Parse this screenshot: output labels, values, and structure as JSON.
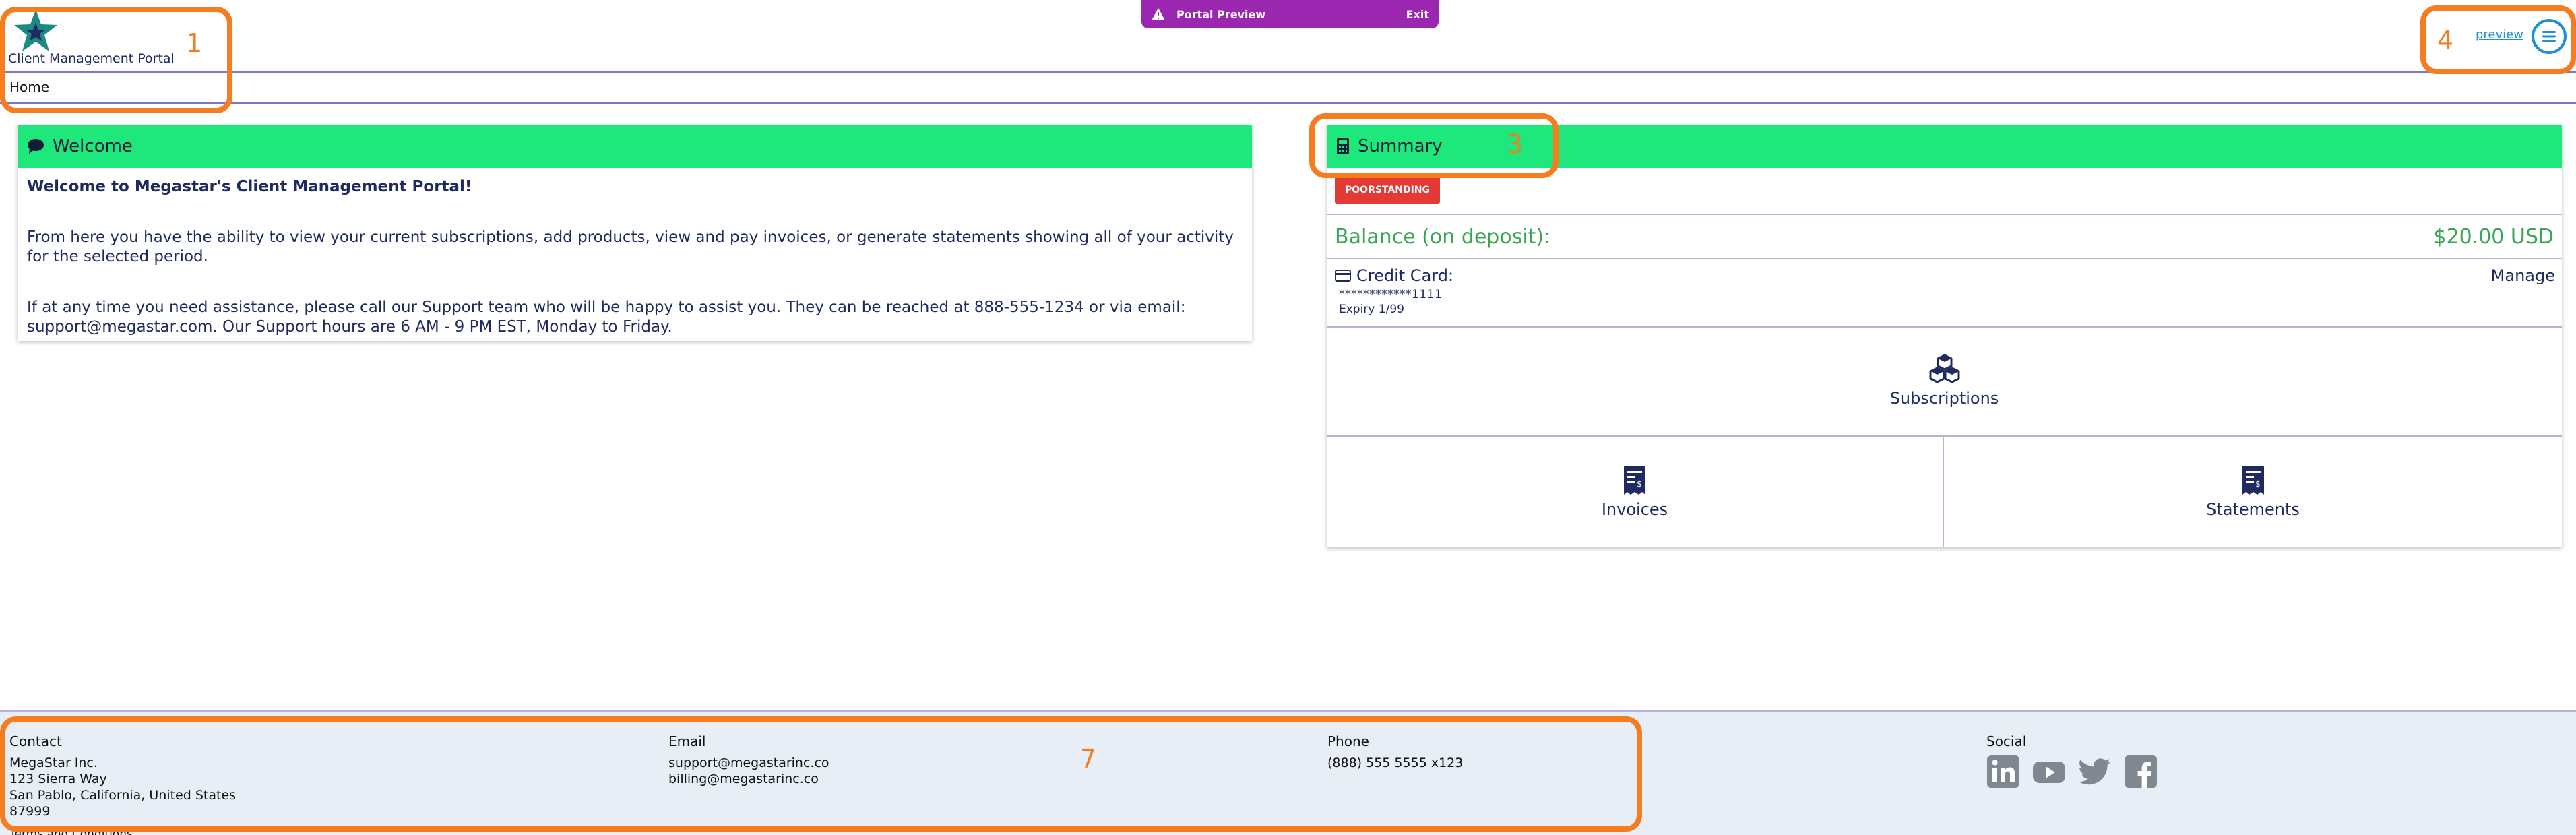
{
  "header": {
    "portal_name": "Client Management Portal",
    "preview_banner": {
      "label": "Portal Preview",
      "exit": "Exit"
    },
    "preview_link": "preview",
    "breadcrumb": "Home"
  },
  "welcome": {
    "title": "Welcome",
    "line1": "Welcome to Megastar's Client Management Portal!",
    "line2": "From here you have the ability to view your current subscriptions, add products, view and pay invoices, or generate statements showing all of your activity for the selected period.",
    "line3": "If at any time you need assistance, please call our Support team who will be happy to assist you. They can be reached at 888-555-1234 or via email: support@megastar.com. Our Support hours are 6 AM - 9 PM EST, Monday to Friday."
  },
  "summary": {
    "title": "Summary",
    "status": "POORSTANDING",
    "balance_label": "Balance (on deposit):",
    "balance_value": "$20.00 USD",
    "card_label": "Credit Card:",
    "card_number": "************1111",
    "card_expiry": "Expiry 1/99",
    "manage": "Manage",
    "tiles": {
      "subscriptions": "Subscriptions",
      "invoices": "Invoices",
      "statements": "Statements"
    }
  },
  "footer": {
    "contact": {
      "heading": "Contact",
      "lines": [
        "MegaStar Inc.",
        "123 Sierra Way",
        "San Pablo, California, United States",
        "87999"
      ]
    },
    "email": {
      "heading": "Email",
      "lines": [
        "support@megastarinc.co",
        "billing@megastarinc.co"
      ]
    },
    "phone": {
      "heading": "Phone",
      "lines": [
        "(888) 555 5555 x123"
      ]
    },
    "social": {
      "heading": "Social",
      "icons": [
        "linkedin-icon",
        "youtube-icon",
        "twitter-icon",
        "facebook-icon"
      ]
    },
    "terms": "Terms and Conditions"
  },
  "annotations": [
    "1",
    "4",
    "3",
    "7"
  ],
  "colors": {
    "accent_green": "#1ee87b",
    "banner_purple": "#9b27b0",
    "annotation_orange": "#f57c1f",
    "link_blue": "#1e90d8",
    "badge_red": "#e53935",
    "text_navy": "#1f2a60"
  }
}
